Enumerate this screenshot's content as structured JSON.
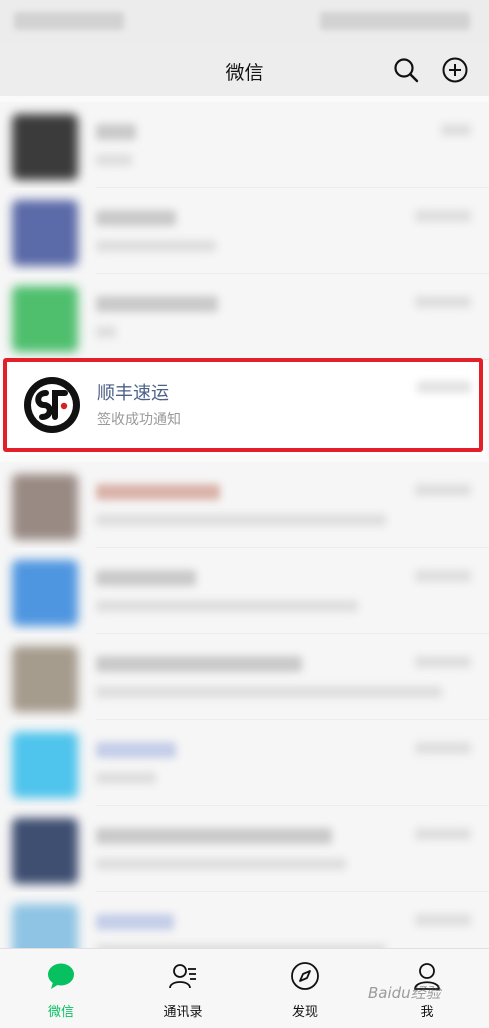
{
  "header": {
    "title": "微信"
  },
  "icons": {
    "search": "search-icon",
    "add": "add-circle-icon"
  },
  "highlighted_chat": {
    "name": "顺丰速运",
    "preview": "签收成功通知",
    "highlight_color": "#e3202a"
  },
  "tabs": [
    {
      "label": "微信",
      "icon": "chat-bubble-icon",
      "active": true
    },
    {
      "label": "通讯录",
      "icon": "contacts-icon",
      "active": false
    },
    {
      "label": "发现",
      "icon": "compass-icon",
      "active": false
    },
    {
      "label": "我",
      "icon": "person-icon",
      "active": false
    }
  ],
  "colors": {
    "accent": "#07c160",
    "name_text": "#4b6187"
  },
  "watermark": "Baidu经验"
}
